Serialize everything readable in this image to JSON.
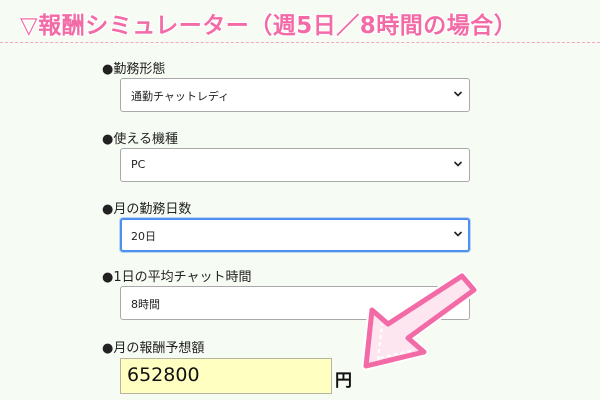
{
  "title": "▽報酬シミュレーター（週5日／8時間の場合）",
  "fields": [
    {
      "label": "●勤務形態",
      "value": "通勤チャットレディ",
      "focused": false
    },
    {
      "label": "●使える機種",
      "value": "PC",
      "focused": false
    },
    {
      "label": "●月の勤務日数",
      "value": "20日",
      "focused": true
    },
    {
      "label": "●1日の平均チャット時間",
      "value": "8時間",
      "focused": false
    }
  ],
  "result": {
    "label": "●月の報酬予想額",
    "value": "652800",
    "unit": "円"
  },
  "icons": {
    "select_chevron": "chevron-down-icon",
    "highlight_arrow": "pink-arrow-icon"
  },
  "colors": {
    "title": "#f26ba6",
    "focus_border": "#4d90f0",
    "result_background": "#ffffc2",
    "arrow": "#f26ba6"
  }
}
